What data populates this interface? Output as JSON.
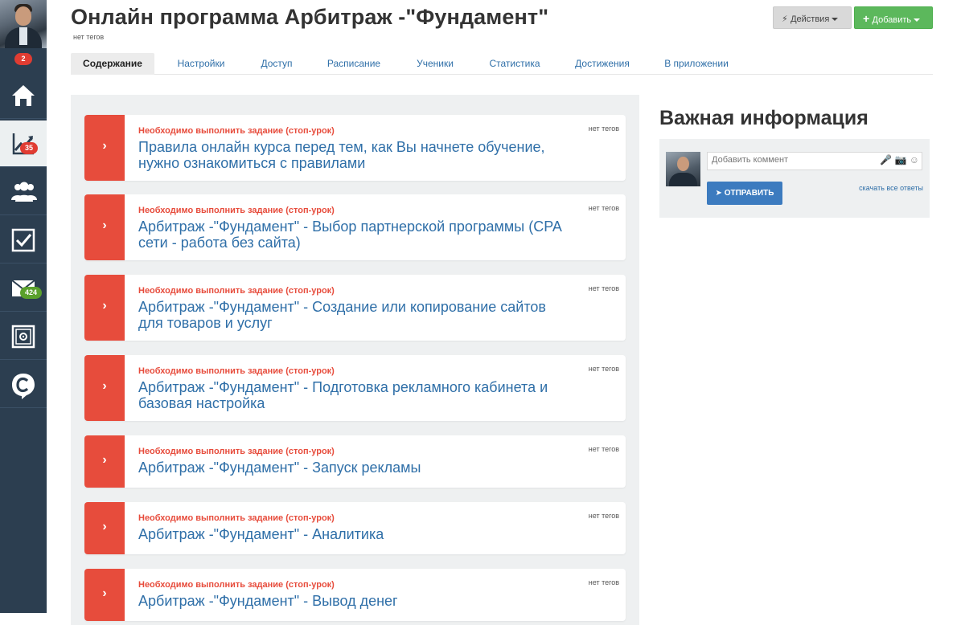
{
  "sidebar": {
    "profile_badge": "2",
    "items": [
      {
        "name": "home",
        "icon": "home-icon",
        "badge": ""
      },
      {
        "name": "courses",
        "icon": "trending-chart-icon",
        "badge": "35"
      },
      {
        "name": "users",
        "icon": "users-icon",
        "badge": ""
      },
      {
        "name": "tasks",
        "icon": "checkbox-icon",
        "badge": ""
      },
      {
        "name": "messages",
        "icon": "envelope-icon",
        "badge": "424"
      },
      {
        "name": "settings",
        "icon": "safe-icon",
        "badge": ""
      },
      {
        "name": "chat",
        "icon": "chat-logo-icon",
        "badge": ""
      }
    ]
  },
  "header": {
    "title": "Онлайн программа Арбитраж -\"Фундамент\"",
    "tags": "нет тегов",
    "actions_label": "Действия",
    "add_label": "Добавить"
  },
  "tabs": [
    {
      "label": "Содержание",
      "active": true
    },
    {
      "label": "Настройки",
      "active": false
    },
    {
      "label": "Доступ",
      "active": false
    },
    {
      "label": "Расписание",
      "active": false
    },
    {
      "label": "Ученики",
      "active": false
    },
    {
      "label": "Статистика",
      "active": false
    },
    {
      "label": "Достижения",
      "active": false
    },
    {
      "label": "В приложении",
      "active": false
    }
  ],
  "lessons": [
    {
      "status": "Необходимо выполнить задание (стоп-урок)",
      "title": "Правила онлайн курса перед тем, как Вы начнете обучение, нужно ознакомиться с правилами",
      "tags": "нет тегов"
    },
    {
      "status": "Необходимо выполнить задание (стоп-урок)",
      "title": "Арбитраж -\"Фундамент\" - Выбор партнерской программы (CPA сети - работа без сайта)",
      "tags": "нет тегов"
    },
    {
      "status": "Необходимо выполнить задание (стоп-урок)",
      "title": "Арбитраж -\"Фундамент\" - Создание или копирование сайтов для товаров и услуг",
      "tags": "нет тегов"
    },
    {
      "status": "Необходимо выполнить задание (стоп-урок)",
      "title": "Арбитраж -\"Фундамент\" - Подготовка рекламного кабинета и базовая настройка",
      "tags": "нет тегов"
    },
    {
      "status": "Необходимо выполнить задание (стоп-урок)",
      "title": "Арбитраж -\"Фундамент\" - Запуск рекламы",
      "tags": "нет тегов"
    },
    {
      "status": "Необходимо выполнить задание (стоп-урок)",
      "title": "Арбитраж -\"Фундамент\" - Аналитика",
      "tags": "нет тегов"
    },
    {
      "status": "Необходимо выполнить задание (стоп-урок)",
      "title": "Арбитраж -\"Фундамент\" - Вывод денег",
      "tags": "нет тегов"
    }
  ],
  "info": {
    "title": "Важная информация",
    "comment_placeholder": "Добавить коммент",
    "send_label": "ОТПРАВИТЬ",
    "download_label": "скачать все ответы"
  },
  "colors": {
    "sidebar_bg": "#2c3e50",
    "accent_red": "#e74c3c",
    "link_blue": "#2f6fa8",
    "add_green": "#5cb85c",
    "send_blue": "#3c7bbf"
  }
}
